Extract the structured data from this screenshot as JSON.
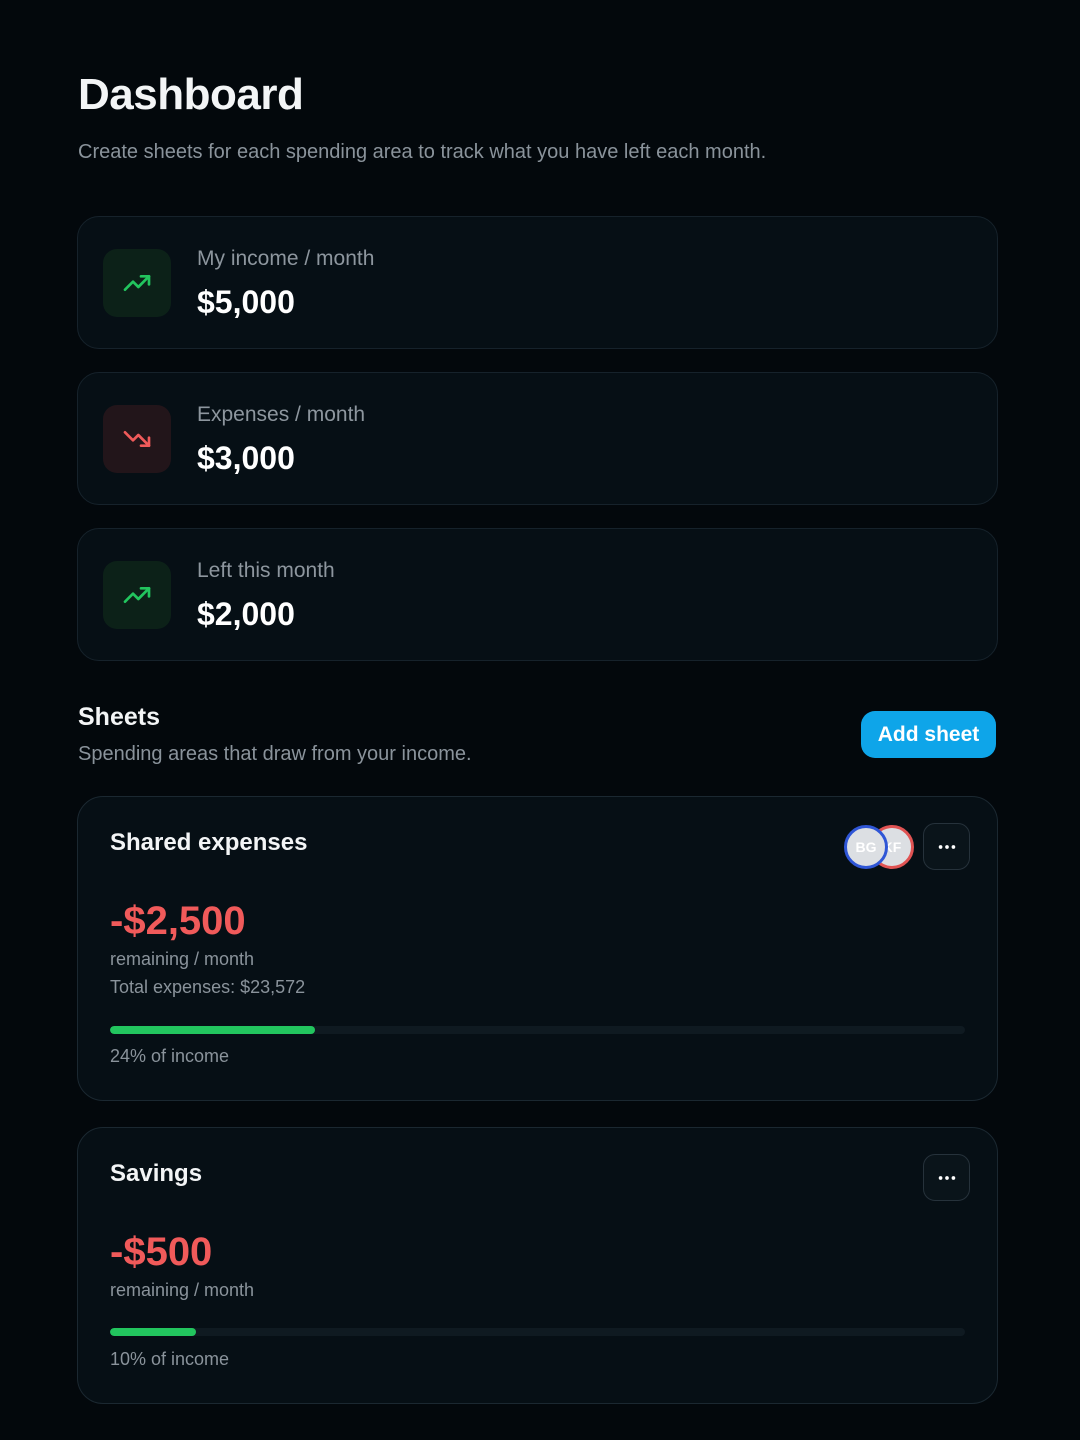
{
  "header": {
    "title": "Dashboard",
    "subtitle": "Create sheets for each spending area to track what you have left each month."
  },
  "stats": [
    {
      "label": "My income / month",
      "value": "$5,000",
      "icon": "trending-up-icon",
      "trend": "up"
    },
    {
      "label": "Expenses / month",
      "value": "$3,000",
      "icon": "trending-down-icon",
      "trend": "down"
    },
    {
      "label": "Left this month",
      "value": "$2,000",
      "icon": "trending-up-icon",
      "trend": "up"
    }
  ],
  "sheets_section": {
    "title": "Sheets",
    "subtitle": "Spending areas that draw from your income.",
    "add_label": "Add sheet"
  },
  "sheets": [
    {
      "name": "Shared expenses",
      "amount": "-$2,500",
      "remaining_label": "remaining / month",
      "total_label": "Total expenses: $23,572",
      "progress_label": "24% of income",
      "progress_fraction": 0.24,
      "members": [
        "BG",
        "KF"
      ],
      "more_icon": "more-horizontal-icon"
    },
    {
      "name": "Savings",
      "amount": "-$500",
      "remaining_label": "remaining / month",
      "progress_label": "10% of income",
      "progress_fraction": 0.1,
      "more_icon": "more-horizontal-icon"
    }
  ],
  "colors": {
    "background": "#03080c",
    "card": "#060f15",
    "accent": "#0ea5e9",
    "positive": "#22c55e",
    "negative": "#f05a5a"
  }
}
